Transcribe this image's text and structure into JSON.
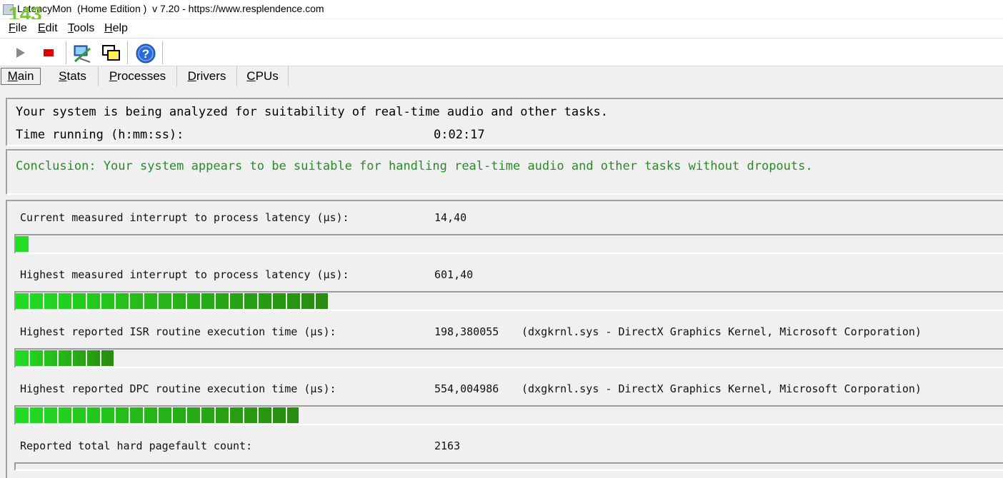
{
  "window": {
    "title": "LatencyMon  (Home Edition )  v 7.20 - https://www.resplendence.com",
    "overlay_number": "143"
  },
  "menu": {
    "file": {
      "first": "F",
      "rest": "ile"
    },
    "edit": {
      "first": "E",
      "rest": "dit"
    },
    "tools": {
      "first": "T",
      "rest": "ools"
    },
    "help": {
      "first": "H",
      "rest": "elp"
    }
  },
  "toolbar": {
    "icons": [
      "play-icon",
      "stop-icon",
      "monitor-tool-icon",
      "windows-icon",
      "help-icon"
    ]
  },
  "tabs": [
    {
      "first": "M",
      "rest": "ain",
      "active": true
    },
    {
      "first": "S",
      "rest": "tats"
    },
    {
      "first": "P",
      "rest": "rocesses"
    },
    {
      "first": "D",
      "rest": "rivers"
    },
    {
      "first": "C",
      "rest": "PUs"
    }
  ],
  "status": {
    "analyzing": "Your system is being analyzed for suitability of real-time audio and other tasks.",
    "time_label": "Time running (h:mm:ss):",
    "time_value": "0:02:17"
  },
  "conclusion": "Conclusion: Your system appears to be suitable for handling real-time audio and other tasks without dropouts.",
  "metrics": [
    {
      "label": "Current measured interrupt to process latency (µs):",
      "value": "14,40",
      "extra": "",
      "fill_fraction": 0.013
    },
    {
      "label": "Highest measured interrupt to process latency (µs):",
      "value": "601,40",
      "extra": "",
      "fill_fraction": 0.315
    },
    {
      "label": "Highest reported ISR routine execution time (µs):",
      "value": "198,380055",
      "extra": "(dxgkrnl.sys - DirectX Graphics Kernel, Microsoft Corporation)",
      "fill_fraction": 0.099
    },
    {
      "label": "Highest reported DPC routine execution time (µs):",
      "value": "554,004986",
      "extra": "(dxgkrnl.sys - DirectX Graphics Kernel, Microsoft Corporation)",
      "fill_fraction": 0.286
    },
    {
      "label": "Reported total hard pagefault count:",
      "value": "2163",
      "extra": "",
      "fill_fraction": null
    }
  ],
  "colors": {
    "bar_green_light": "#22dd22",
    "bar_green_dark": "#2a8a10",
    "conclusion_green": "#2a8a2a"
  }
}
